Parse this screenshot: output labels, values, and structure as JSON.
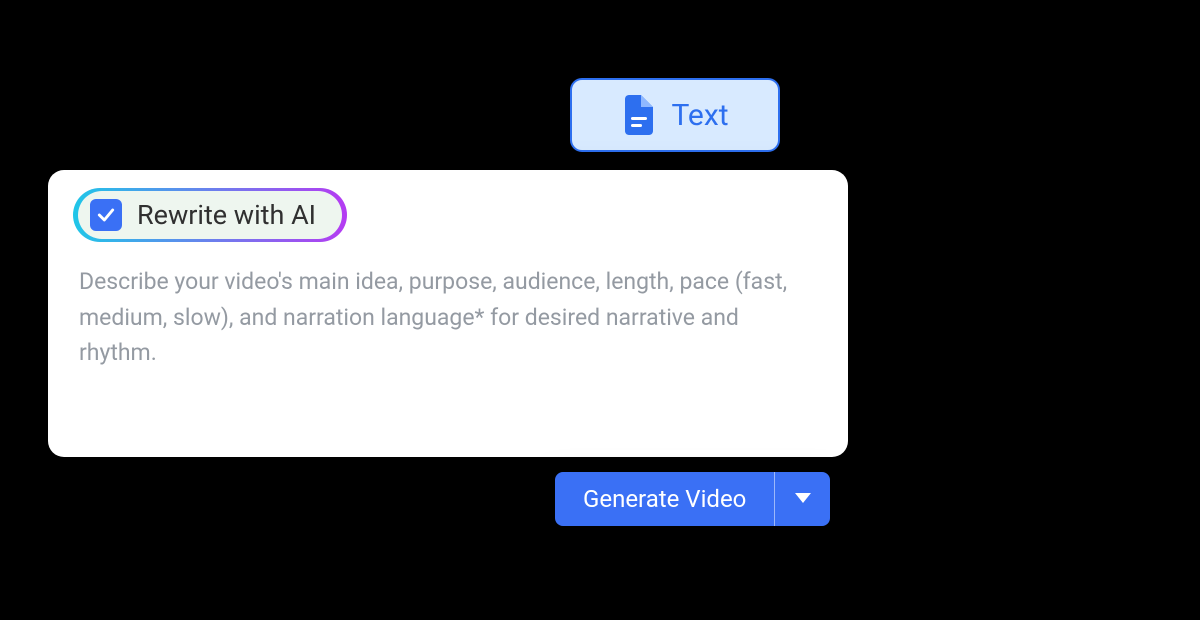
{
  "tab": {
    "label": "Text"
  },
  "rewrite": {
    "label": "Rewrite with AI",
    "checked": true
  },
  "prompt": {
    "placeholder": "Describe your video's main idea, purpose, audience, length, pace (fast, medium, slow), and narration language* for desired narrative and rhythm."
  },
  "actions": {
    "generate_label": "Generate Video"
  },
  "colors": {
    "accent": "#3a70f5",
    "tab_bg": "#d8eaff",
    "gradient_start": "#1fc6e8",
    "gradient_end": "#b53bf2"
  }
}
